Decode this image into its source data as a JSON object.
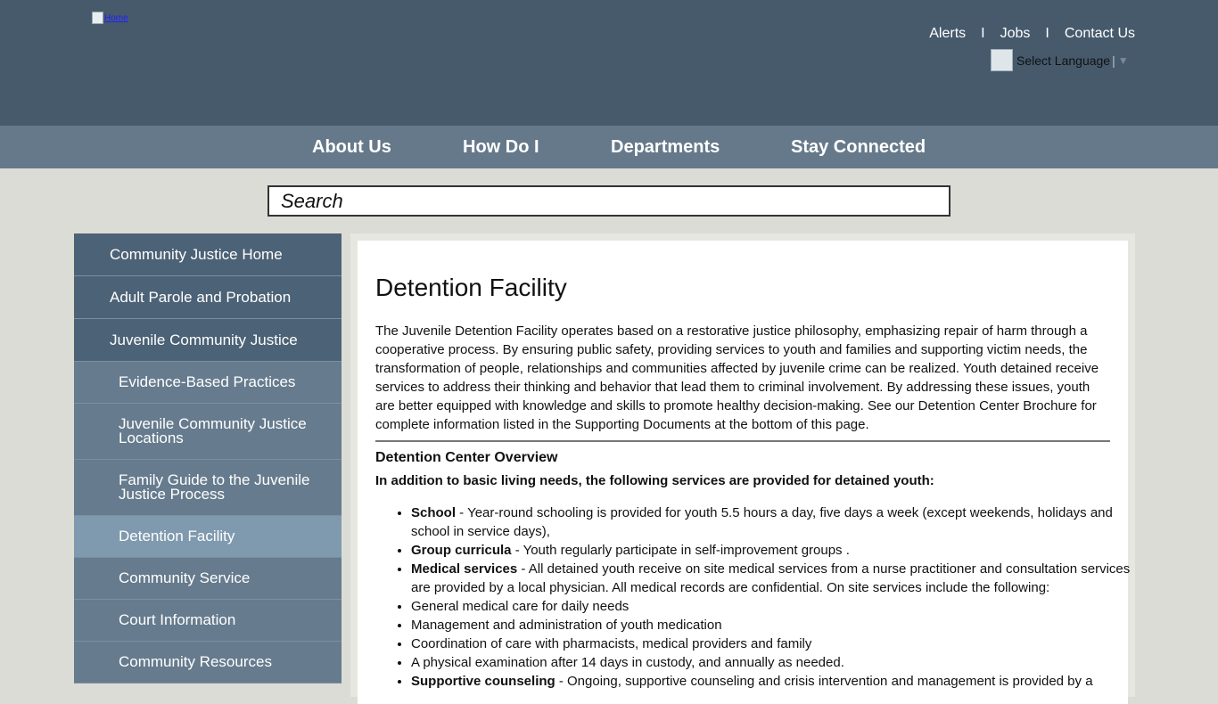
{
  "header": {
    "logo_alt": "Home",
    "top_links": [
      "Alerts",
      "Jobs",
      "Contact Us"
    ],
    "separator": "I",
    "language_label": "Select Language",
    "language_bar": "|",
    "language_caret": "▼"
  },
  "nav": {
    "items": [
      "About Us",
      "How Do I",
      "Departments",
      "Stay Connected"
    ]
  },
  "search": {
    "placeholder": "Search"
  },
  "sidebar": {
    "items": [
      "Community Justice Home",
      "Adult Parole and Probation",
      "Juvenile Community Justice",
      "Evidence-Based Practices",
      "Juvenile Community Justice Locations",
      "Family Guide to the Juvenile Justice Process",
      "Detention Facility",
      "Community Service",
      "Court Information",
      "Community Resources"
    ]
  },
  "main": {
    "title": "Detention Facility",
    "intro": "The Juvenile Detention Facility operates based on a restorative justice philosophy, emphasizing repair of harm through a cooperative process. By ensuring public safety, providing services to youth and families and supporting victim needs, the transformation of people, relationships and communities affected by juvenile crime can be realized. Youth detained receive services to address their thinking and behavior that lead them to criminal involvement. By addressing these issues, youth are better equipped with knowledge and skills to promote healthy decision-making. See our Detention Center Brochure for complete information listed in the Supporting Documents at the bottom of this page.",
    "section_title": "Detention Center Overview",
    "lead": "In addition to basic living needs, the following services are provided for detained youth:",
    "list": [
      {
        "term": "School",
        "text": " - Year-round schooling is provided for youth 5.5 hours a day, five days a week (except weekends, holidays and school in service days),"
      },
      {
        "term": "Group curricula",
        "text": " - Youth regularly participate in self-improvement groups ."
      },
      {
        "term": "Medical services",
        "text": " - All detained youth receive on site medical services from a nurse practitioner and consultation services are provided by a local physician.  All medical records are confidential.  On site services include the following:"
      },
      {
        "term": "",
        "text": "General medical care for daily needs"
      },
      {
        "term": "",
        "text": "Management and administration of youth medication"
      },
      {
        "term": "",
        "text": "Coordination of care with pharmacists, medical providers and family"
      },
      {
        "term": "",
        "text": "A physical examination after 14 days in custody, and annually as needed."
      },
      {
        "term": "Supportive counseling",
        "text": " - Ongoing, supportive counseling and crisis intervention and management is provided by a"
      }
    ]
  }
}
